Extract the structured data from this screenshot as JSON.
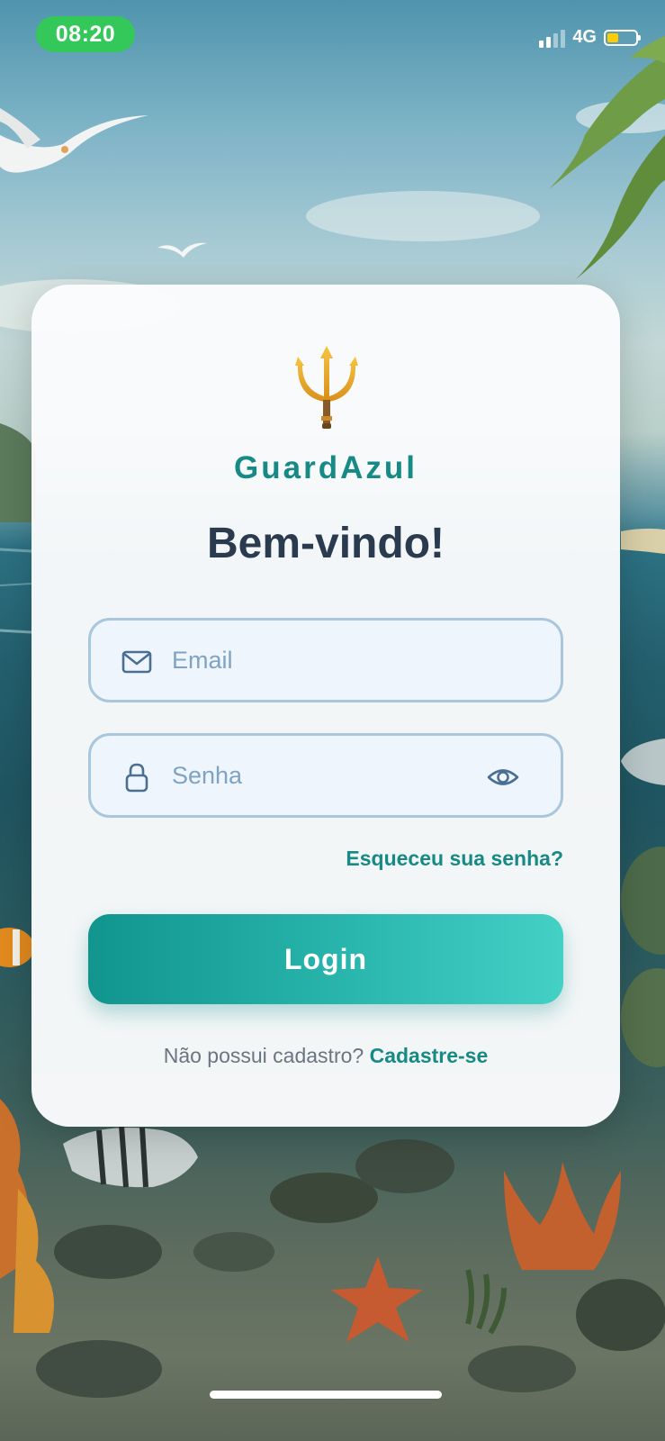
{
  "status_bar": {
    "time": "08:20",
    "network": "4G",
    "battery_level": 0.4,
    "battery_color": "#ffcc00",
    "time_pill_color": "#34c759"
  },
  "app": {
    "brand_name": "GuardAzul",
    "logo_icon": "trident-icon",
    "welcome": "Bem-vindo!"
  },
  "form": {
    "email_placeholder": "Email",
    "email_icon": "mail-icon",
    "password_placeholder": "Senha",
    "password_icon": "lock-icon",
    "toggle_visibility_icon": "eye-icon",
    "forgot_password": "Esqueceu sua senha?",
    "login_label": "Login"
  },
  "signup": {
    "prompt": "Não possui cadastro?",
    "link": "Cadastre-se"
  },
  "colors": {
    "accent": "#178a86",
    "heading": "#2b3b4f",
    "input_border": "#a9c7dc",
    "input_bg": "#eef5fc",
    "placeholder": "#7fa3c1"
  }
}
